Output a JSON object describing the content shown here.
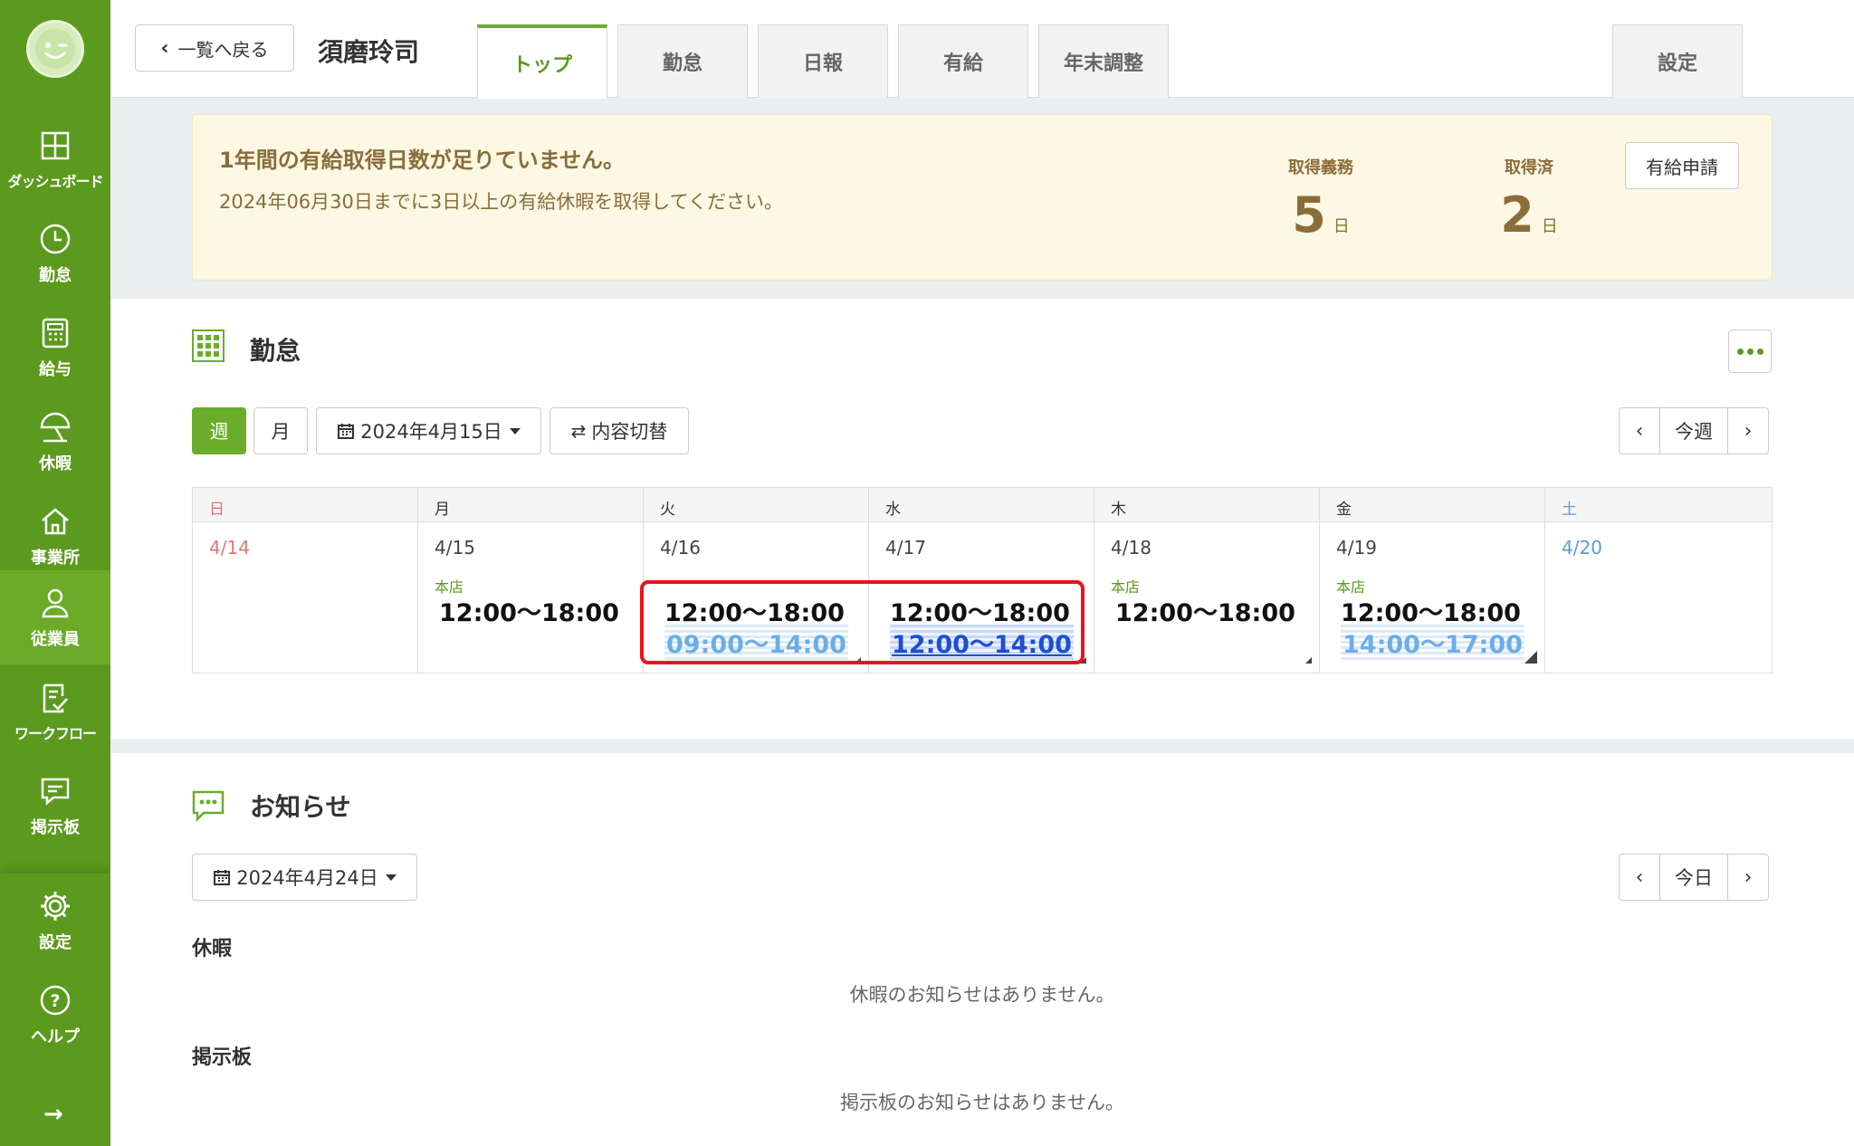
{
  "sidebar": {
    "items": [
      {
        "label": "ダッシュボード",
        "icon": "dashboard-icon"
      },
      {
        "label": "勤怠",
        "icon": "clock-icon"
      },
      {
        "label": "給与",
        "icon": "calculator-icon"
      },
      {
        "label": "休暇",
        "icon": "umbrella-icon"
      },
      {
        "label": "事業所",
        "icon": "home-icon"
      },
      {
        "label": "従業員",
        "icon": "person-icon"
      },
      {
        "label": "ワークフロー",
        "icon": "workflow-icon"
      },
      {
        "label": "掲示板",
        "icon": "message-icon"
      }
    ],
    "bottom": [
      {
        "label": "設定",
        "icon": "gear-icon"
      },
      {
        "label": "ヘルプ",
        "icon": "help-icon"
      }
    ],
    "expand": "→"
  },
  "header": {
    "back_label": "一覧へ戻る",
    "employee_name": "須磨玲司",
    "tabs": [
      "トップ",
      "勤怠",
      "日報",
      "有給",
      "年末調整"
    ],
    "settings_tab": "設定"
  },
  "alert": {
    "title": "1年間の有給取得日数が足りていません。",
    "message": "2024年06月30日までに3日以上の有給休暇を取得してください。",
    "required_label": "取得義務",
    "required_value": "5",
    "taken_label": "取得済",
    "taken_value": "2",
    "unit": "日",
    "apply_label": "有給申請"
  },
  "attendance": {
    "title": "勤怠",
    "week_label": "週",
    "month_label": "月",
    "date_select": "2024年4月15日",
    "toggle_label": "内容切替",
    "prev": "‹",
    "this_week": "今週",
    "next": "›",
    "days": [
      {
        "dow": "日",
        "date": "4/14",
        "store": "",
        "shift": "",
        "plan": ""
      },
      {
        "dow": "月",
        "date": "4/15",
        "store": "本店",
        "shift": "12:00～18:00",
        "plan": ""
      },
      {
        "dow": "火",
        "date": "4/16",
        "store": "",
        "shift": "12:00～18:00",
        "plan": "09:00～14:00"
      },
      {
        "dow": "水",
        "date": "4/17",
        "store": "",
        "shift": "12:00～18:00",
        "plan": "12:00～14:00"
      },
      {
        "dow": "木",
        "date": "4/18",
        "store": "本店",
        "shift": "12:00～18:00",
        "plan": ""
      },
      {
        "dow": "金",
        "date": "4/19",
        "store": "本店",
        "shift": "12:00～18:00",
        "plan": "14:00～17:00"
      },
      {
        "dow": "土",
        "date": "4/20",
        "store": "",
        "shift": "",
        "plan": ""
      }
    ]
  },
  "notices": {
    "title": "お知らせ",
    "date_select": "2024年4月24日",
    "prev": "‹",
    "today": "今日",
    "next": "›",
    "leave_heading": "休暇",
    "leave_empty": "休暇のお知らせはありません。",
    "board_heading": "掲示板",
    "board_empty": "掲示板のお知らせはありません。"
  },
  "colors": {
    "sidebar": "#5b9a1e",
    "accent": "#6aad2a",
    "alert_bg": "#fcf8e3",
    "alert_text": "#8a6d3b",
    "highlight": "#e8141c"
  }
}
